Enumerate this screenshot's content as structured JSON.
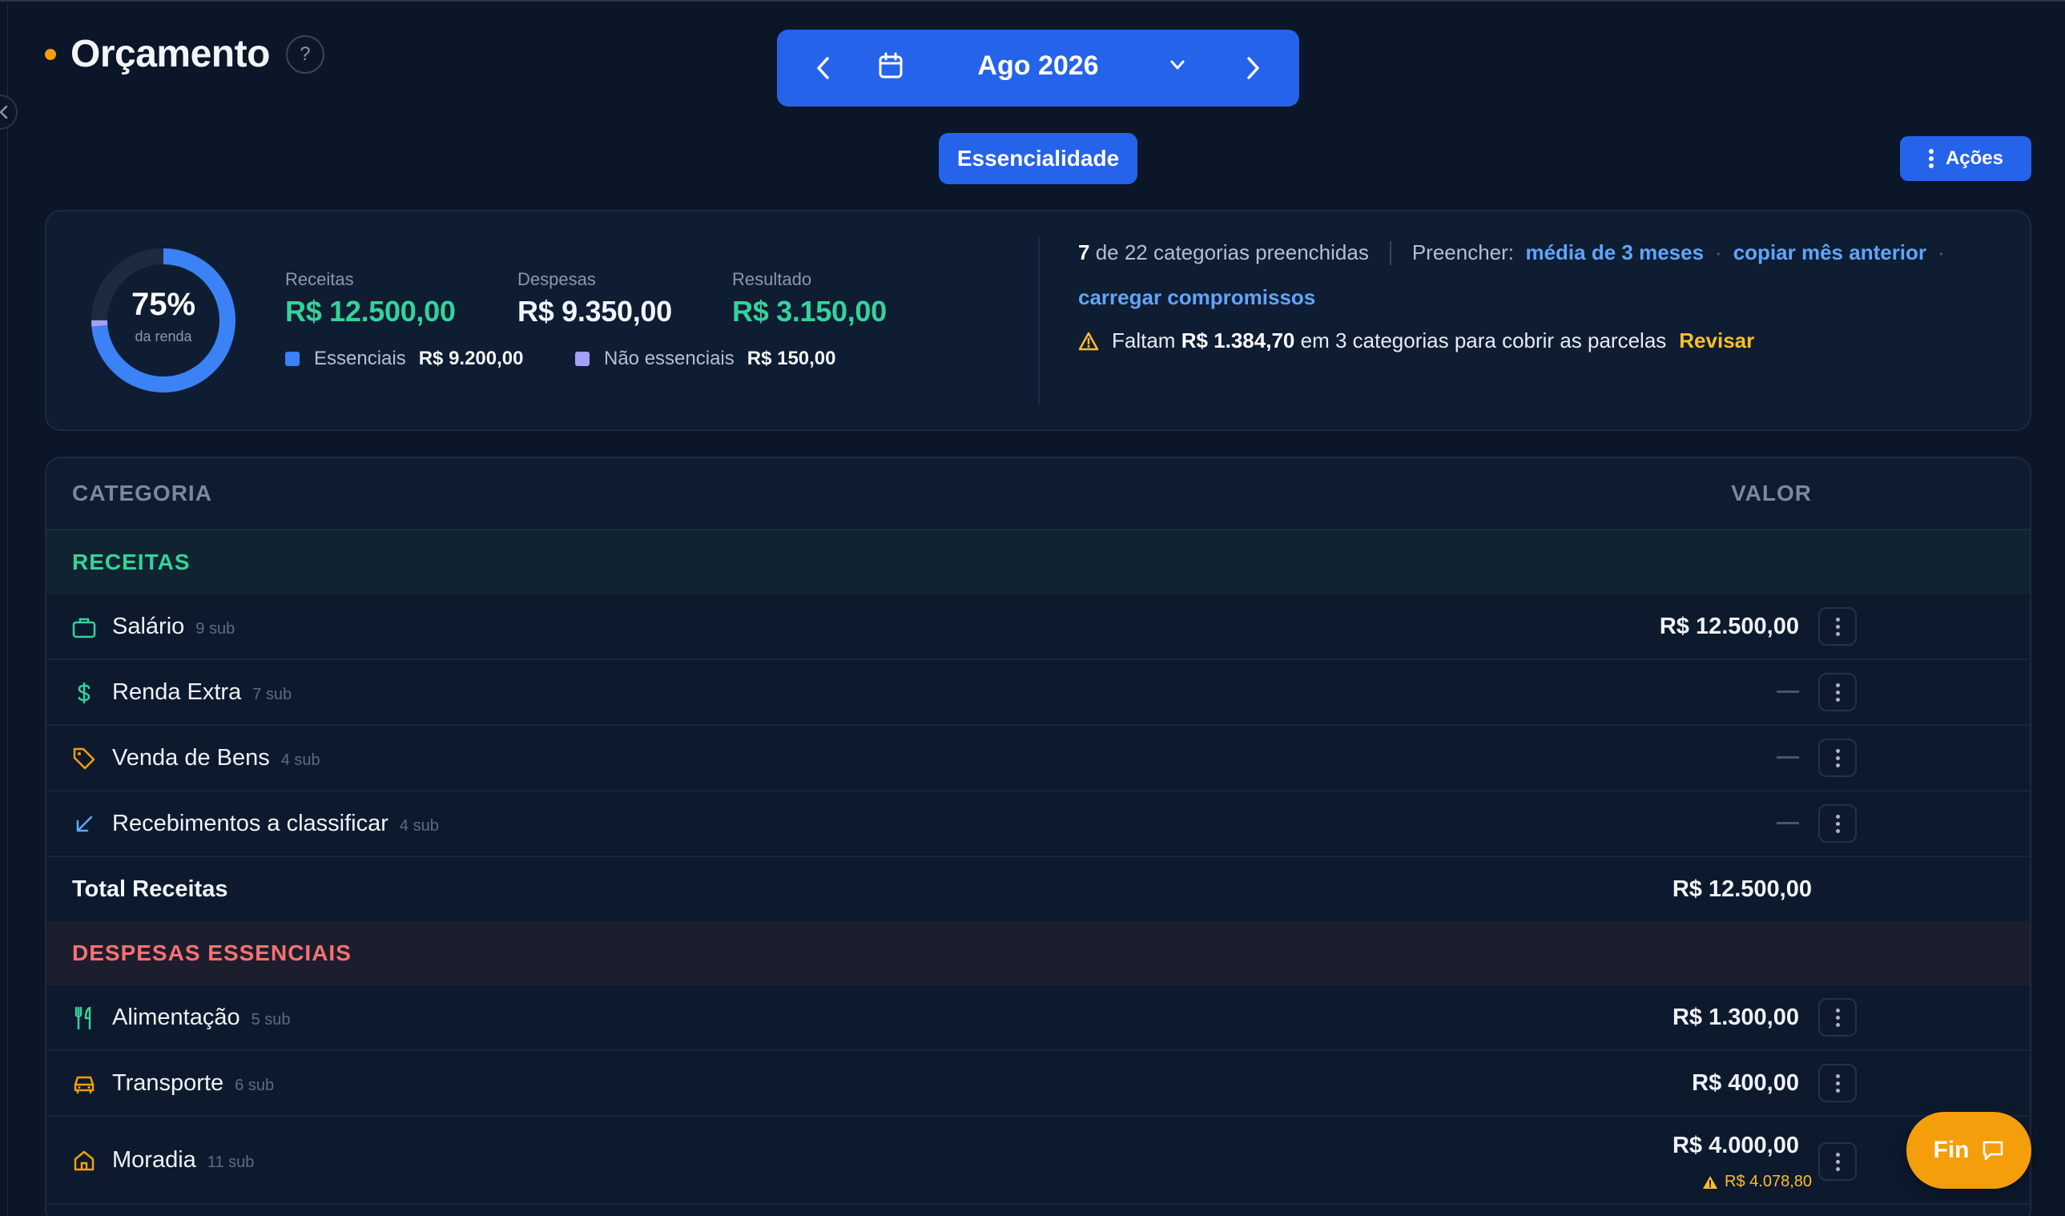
{
  "header": {
    "title": "Orçamento",
    "help": "?",
    "month": "Ago 2026",
    "essencialidade": "Essencialidade",
    "acoes": "Ações"
  },
  "summary": {
    "percent": "75%",
    "percent_sub": "da renda",
    "income_share": 0.75,
    "receitas_label": "Receitas",
    "receitas_value": "R$ 12.500,00",
    "despesas_label": "Despesas",
    "despesas_value": "R$ 9.350,00",
    "resultado_label": "Resultado",
    "resultado_value": "R$ 3.150,00",
    "essenciais_label": "Essenciais",
    "essenciais_value": "R$ 9.200,00",
    "nao_essenciais_label": "Não essenciais",
    "nao_essenciais_value": "R$ 150,00",
    "filled_count": "7",
    "filled_text": "de 22 categorias preenchidas",
    "preencher_label": "Preencher:",
    "link_media": "média de 3 meses",
    "link_copiar": "copiar mês anterior",
    "link_carregar": "carregar compromissos",
    "warn_prefix": "Faltam",
    "warn_amount": "R$ 1.384,70",
    "warn_suffix": "em 3 categorias para cobrir as parcelas",
    "warn_action": "Revisar"
  },
  "table": {
    "col_categoria": "CATEGORIA",
    "col_valor": "VALOR",
    "receitas_section": "RECEITAS",
    "receitas": [
      {
        "name": "Salário",
        "sub": "9 sub",
        "value": "R$ 12.500,00",
        "icon": "briefcase-icon"
      },
      {
        "name": "Renda Extra",
        "sub": "7 sub",
        "value": "",
        "icon": "dollar-icon"
      },
      {
        "name": "Venda de Bens",
        "sub": "4 sub",
        "value": "",
        "icon": "tag-icon"
      },
      {
        "name": "Recebimentos a classificar",
        "sub": "4 sub",
        "value": "",
        "icon": "arrow-down-left-icon"
      }
    ],
    "total_receitas_label": "Total Receitas",
    "total_receitas_value": "R$ 12.500,00",
    "despesas_section": "DESPESAS ESSENCIAIS",
    "despesas": [
      {
        "name": "Alimentação",
        "sub": "5 sub",
        "value": "R$ 1.300,00",
        "icon": "utensils-icon"
      },
      {
        "name": "Transporte",
        "sub": "6 sub",
        "value": "R$ 400,00",
        "icon": "car-icon"
      },
      {
        "name": "Moradia",
        "sub": "11 sub",
        "value": "R$ 4.000,00",
        "warn": "R$ 4.078,80",
        "icon": "home-icon"
      }
    ]
  },
  "fin_button": "Fin",
  "colors": {
    "accent": "#2563eb",
    "positive": "#34d399",
    "negative": "#f87171",
    "warning": "#fbbf24",
    "orange": "#f59e0b"
  }
}
